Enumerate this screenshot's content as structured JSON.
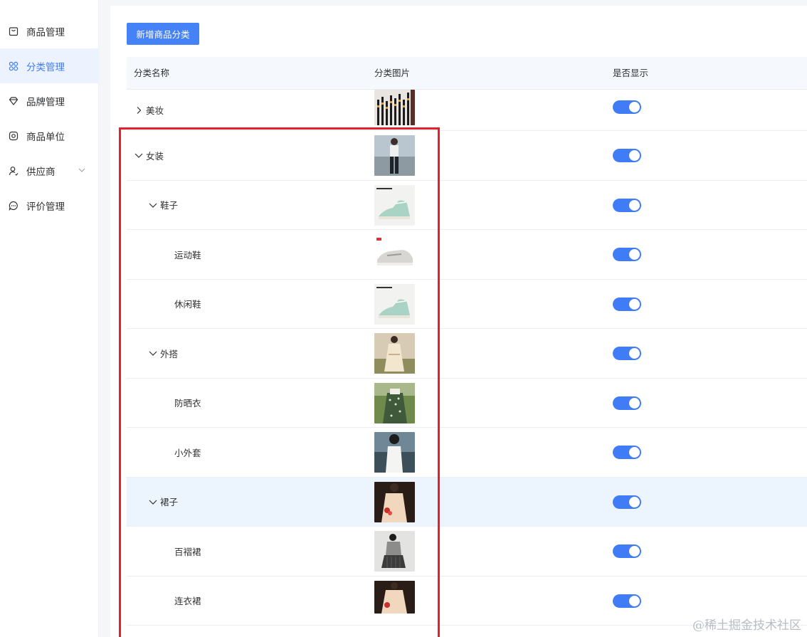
{
  "sidebar": {
    "items": [
      {
        "label": "商品管理",
        "icon": "bag-icon",
        "active": false
      },
      {
        "label": "分类管理",
        "icon": "grid-icon",
        "active": true
      },
      {
        "label": "品牌管理",
        "icon": "diamond-icon",
        "active": false
      },
      {
        "label": "商品单位",
        "icon": "circle-icon",
        "active": false
      },
      {
        "label": "供应商",
        "icon": "user-icon",
        "active": false,
        "has_submenu": true
      },
      {
        "label": "评价管理",
        "icon": "chat-icon",
        "active": false
      }
    ]
  },
  "toolbar": {
    "add_label": "新增商品分类"
  },
  "table": {
    "headers": {
      "name": "分类名称",
      "image": "分类图片",
      "visible": "是否显示"
    },
    "rows": [
      {
        "name": "美妆",
        "level": 0,
        "caret": "right",
        "image": "brushes",
        "visible": true
      },
      {
        "name": "女装",
        "level": 0,
        "caret": "down",
        "image": "woman-jeans",
        "visible": true
      },
      {
        "name": "鞋子",
        "level": 1,
        "caret": "down",
        "image": "converse-sneaker",
        "visible": true
      },
      {
        "name": "运动鞋",
        "level": 2,
        "caret": "none",
        "image": "nb-sneaker",
        "visible": true
      },
      {
        "name": "休闲鞋",
        "level": 2,
        "caret": "none",
        "image": "converse-sneaker",
        "visible": true
      },
      {
        "name": "外搭",
        "level": 1,
        "caret": "down",
        "image": "beige-dress",
        "visible": true
      },
      {
        "name": "防晒衣",
        "level": 2,
        "caret": "none",
        "image": "floral-dress",
        "visible": true
      },
      {
        "name": "小外套",
        "level": 2,
        "caret": "none",
        "image": "white-dress-sea",
        "visible": true
      },
      {
        "name": "裙子",
        "level": 1,
        "caret": "down",
        "image": "cream-dress",
        "visible": true,
        "highlight": true
      },
      {
        "name": "百褶裙",
        "level": 2,
        "caret": "none",
        "image": "grey-skirt",
        "visible": true
      },
      {
        "name": "连衣裙",
        "level": 2,
        "caret": "none",
        "image": "cream-dress",
        "visible": true
      }
    ]
  },
  "colors": {
    "accent": "#3f7cf5",
    "annotation": "#e3202b"
  },
  "watermark": "@稀土掘金技术社区"
}
